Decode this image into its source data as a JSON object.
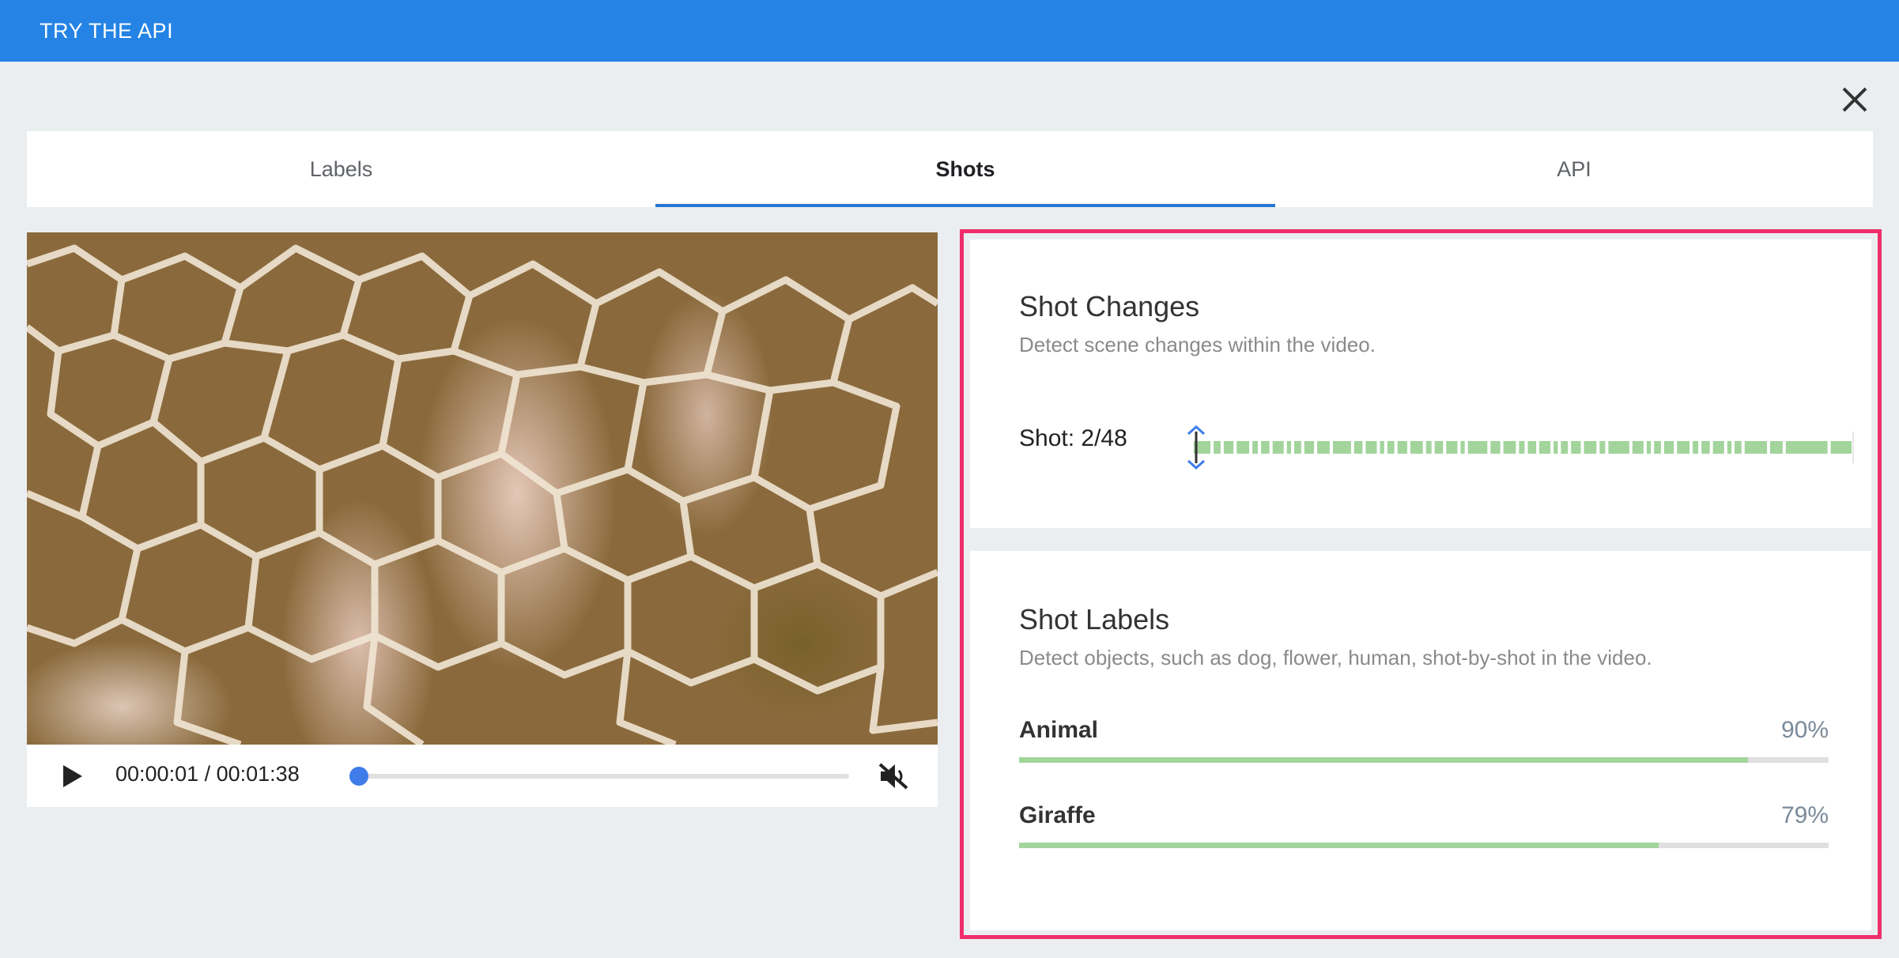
{
  "header": {
    "title": "TRY THE API"
  },
  "tabs": [
    {
      "label": "Labels",
      "active": false
    },
    {
      "label": "Shots",
      "active": true
    },
    {
      "label": "API",
      "active": false
    }
  ],
  "player": {
    "time_display": "00:00:01 / 00:01:38",
    "progress": 0.01,
    "muted": true,
    "accent_color": "#3f7ce9"
  },
  "shot_changes": {
    "title": "Shot Changes",
    "description": "Detect scene changes within the video.",
    "shot_label": "Shot: 2/48",
    "current_shot": 2,
    "total_shots": 48,
    "segment_color": "#a2d49b"
  },
  "shot_labels": {
    "title": "Shot Labels",
    "description": "Detect objects, such as dog, flower, human, shot-by-shot in the video.",
    "items": [
      {
        "name": "Animal",
        "percent_text": "90%",
        "confidence": 0.9
      },
      {
        "name": "Giraffe",
        "percent_text": "79%",
        "confidence": 0.79
      }
    ]
  },
  "colors": {
    "header_bg": "#2483e4",
    "highlight_border": "#ef2f6a",
    "tab_underline": "#2477d4"
  }
}
